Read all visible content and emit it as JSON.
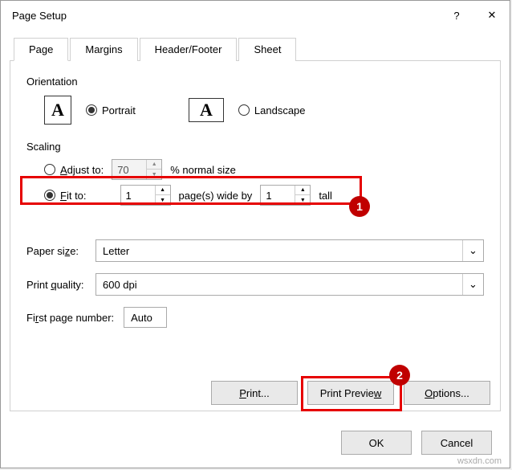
{
  "window": {
    "title": "Page Setup",
    "help": "?",
    "close": "✕"
  },
  "tabs": {
    "page": "Page",
    "margins": "Margins",
    "headerfooter": "Header/Footer",
    "sheet": "Sheet"
  },
  "orientation": {
    "title": "Orientation",
    "portrait": "Portrait",
    "landscape": "Landscape"
  },
  "scaling": {
    "title": "Scaling",
    "adjust_label": "Adjust to:",
    "adjust_value": "70",
    "adjust_suffix": "% normal size",
    "fit_label": "Fit to:",
    "fit_wide": "1",
    "fit_middle": "page(s) wide by",
    "fit_tall_value": "1",
    "fit_tall_label": "tall"
  },
  "paper": {
    "label": "Paper size:",
    "value": "Letter"
  },
  "quality": {
    "label": "Print quality:",
    "value": "600 dpi"
  },
  "firstpage": {
    "label": "First page number:",
    "value": "Auto"
  },
  "buttons": {
    "print": "Print...",
    "preview": "Print Preview",
    "options": "Options...",
    "ok": "OK",
    "cancel": "Cancel"
  },
  "callouts": {
    "one": "1",
    "two": "2"
  },
  "watermark": "wsxdn.com"
}
